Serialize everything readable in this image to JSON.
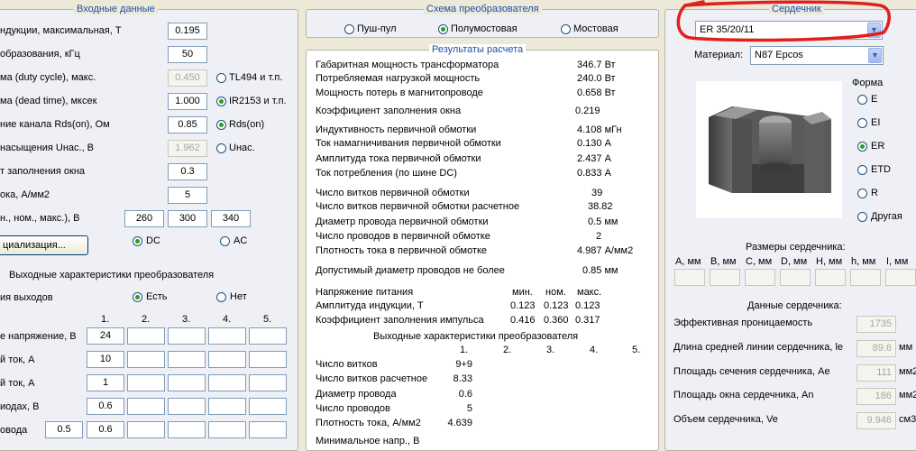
{
  "input": {
    "title": "Входные данные",
    "rows": [
      {
        "label": "ндукции, максимальная, Т",
        "value": "0.195"
      },
      {
        "label": "образования, кГц",
        "value": "50"
      },
      {
        "label": "ма (duty cycle), макс.",
        "value": "0.450",
        "radio": "TL494 и т.п."
      },
      {
        "label": "ма (dead time), мксек",
        "value": "1.000",
        "radio": "IR2153 и т.п."
      },
      {
        "label": "ние канала Rds(on), Ом",
        "value": "0.85",
        "radio": "Rds(on)"
      },
      {
        "label": "насыщения Uнас., В",
        "value": "1.962",
        "radio": "Uнас."
      },
      {
        "label": "т заполнения окна",
        "value": "0.3"
      },
      {
        "label": "ока, А/мм2",
        "value": "5"
      }
    ],
    "voltage_label": "н., ном., макс.), В",
    "voltage_values": [
      "260",
      "300",
      "340"
    ],
    "init_button": "циализация...",
    "dc_label": "DC",
    "ac_label": "AC"
  },
  "outputs": {
    "title": "Выходные характеристики преобразователя",
    "has_outputs_label": "ия выходов",
    "yes_label": "Есть",
    "no_label": "Нет",
    "columns": [
      "1.",
      "2.",
      "3.",
      "4.",
      "5."
    ],
    "rows": [
      {
        "label": "е напряжение, В",
        "value": "24"
      },
      {
        "label": "й ток, А",
        "value": "10"
      },
      {
        "label": "й ток, А",
        "value": "1"
      },
      {
        "label": "иодах, В",
        "value": "0.6"
      },
      {
        "label": "овода",
        "pre": "0.5",
        "value": "0.6"
      }
    ]
  },
  "scheme": {
    "title": "Схема преобразователя",
    "options": [
      "Пуш-пул",
      "Полумостовая",
      "Мостовая"
    ],
    "selected": 1
  },
  "results": {
    "title": "Результаты расчета",
    "lines": [
      {
        "label": "Габаритная мощность трансформатора",
        "value": "346.7 Вт"
      },
      {
        "label": "Потребляемая нагрузкой мощность",
        "value": "240.0 Вт"
      },
      {
        "label": "Мощность потерь в магнитопроводе",
        "value": "0.658 Вт"
      },
      {
        "label": "Коэффициент заполнения окна",
        "value": "0.219"
      },
      {
        "label": "Индуктивность первичной обмотки",
        "value": "4.108 мГн"
      },
      {
        "label": "Ток намагничивания первичной обмотки",
        "value": "0.130 А"
      },
      {
        "label": "Амплитуда тока первичной обмотки",
        "value": "2.437 А"
      },
      {
        "label": "Ток потребления (по шине DC)",
        "value": "0.833 А"
      },
      {
        "label": "Число витков первичной обмотки",
        "value": "39"
      },
      {
        "label": "Число витков первичной обмотки расчетное",
        "value": "38.82"
      },
      {
        "label": "Диаметр провода первичной обмотки",
        "value": "0.5 мм"
      },
      {
        "label": "Число проводов в первичной обмотке",
        "value": "2"
      },
      {
        "label": "Плотность тока в первичной обмотке",
        "value": "4.987 А/мм2"
      },
      {
        "label": "Допустимый диаметр проводов не более",
        "value": "0.85 мм"
      }
    ],
    "mm_headers": [
      "мин.",
      "ном.",
      "макс."
    ],
    "mm_rows": [
      {
        "label": "Напряжение питания",
        "values": [
          "",
          "",
          ""
        ]
      },
      {
        "label": "Амплитуда индукции, Т",
        "values": [
          "0.123",
          "0.123",
          "0.123"
        ]
      },
      {
        "label": "Коэффициент заполнения импульса",
        "values": [
          "0.416",
          "0.360",
          "0.317"
        ]
      }
    ],
    "out_title": "Выходные характеристики преобразователя",
    "out_columns": [
      "1.",
      "2.",
      "3.",
      "4.",
      "5."
    ],
    "out_rows": [
      {
        "label": "Число витков",
        "value": "9+9"
      },
      {
        "label": "Число витков расчетное",
        "value": "8.33"
      },
      {
        "label": "Диаметр провода",
        "value": "0.6"
      },
      {
        "label": "Число проводов",
        "value": "5"
      },
      {
        "label": "Плотность тока, А/мм2",
        "value": "4.639"
      },
      {
        "label": "Минимальное напр., В",
        "value": ""
      }
    ]
  },
  "core": {
    "title": "Сердечник",
    "selected": "ER 35/20/11",
    "material_label": "Материал:",
    "material": "N87 Epcos",
    "shape_title": "Форма",
    "shapes": [
      "E",
      "EI",
      "ER",
      "ETD",
      "R",
      "Другая"
    ],
    "shape_selected": 2,
    "dims_title": "Размеры сердечника:",
    "dims": [
      "A, мм",
      "B, мм",
      "C, мм",
      "D, мм",
      "H, мм",
      "h, мм",
      "I, мм"
    ],
    "data_title": "Данные сердечника:",
    "params": [
      {
        "label": "Эффективная проницаемость",
        "value": "1735",
        "unit": ""
      },
      {
        "label": "Длина средней линии сердечника, le",
        "value": "89.6",
        "unit": "мм"
      },
      {
        "label": "Площадь сечения сердечника, Ae",
        "value": "111",
        "unit": "мм2"
      },
      {
        "label": "Площадь окна сердечника, An",
        "value": "186",
        "unit": "мм2"
      },
      {
        "label": "Объем сердечника, Ve",
        "value": "9.946",
        "unit": "см3"
      }
    ]
  },
  "colors": {
    "annotation": "#e0201a",
    "legend": "#1f4fa8",
    "radio_dot": "#21a121"
  }
}
